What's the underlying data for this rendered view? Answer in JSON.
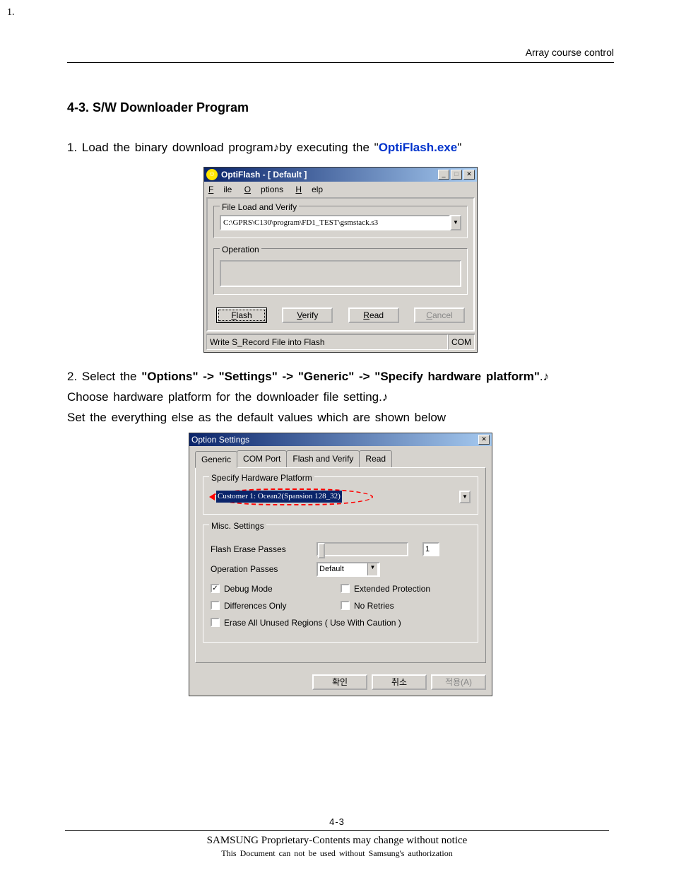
{
  "outer_number": "1.",
  "page_header": "Array course control",
  "section_title": "4-3. S/W Downloader Program",
  "intro": {
    "prefix": "1. Load the binary download program♪by executing the \"",
    "highlight": "OptiFlash.exe",
    "suffix": "\""
  },
  "win1": {
    "title": "OptiFlash - [ Default ]",
    "menu": {
      "file": "File",
      "options": "Options",
      "help": "Help"
    },
    "group1": {
      "legend": "File Load and Verify",
      "path": "C:\\GPRS\\C130\\program\\FD1_TEST\\gsmstack.s3"
    },
    "group2": {
      "legend": "Operation"
    },
    "buttons": {
      "flash": "Flash",
      "verify": "Verify",
      "read": "Read",
      "cancel": "Cancel"
    },
    "status_left": "Write S_Record File into Flash",
    "status_right": "COM"
  },
  "midtext": {
    "line1_prefix": "2. Select the ",
    "line1_bold": "\"Options\" -> \"Settings\" -> \"Generic\" -> \"Specify hardware platform\"",
    "line1_suffix": ".♪",
    "line2": "Choose hardware platform for the downloader file setting.♪",
    "line3": "Set the everything else as the default values which are shown below"
  },
  "win2": {
    "title": "Option Settings",
    "tabs": [
      "Generic",
      "COM Port",
      "Flash and Verify",
      "Read"
    ],
    "group_hw": {
      "legend": "Specify Hardware Platform",
      "value": "Customer 1: Ocean2(Spansion 128_32)"
    },
    "group_misc": {
      "legend": "Misc. Settings",
      "flash_erase_label": "Flash Erase Passes",
      "flash_erase_value": "1",
      "operation_passes_label": "Operation Passes",
      "operation_passes_value": "Default",
      "debug_mode": "Debug Mode",
      "extended_protection": "Extended Protection",
      "differences_only": "Differences Only",
      "no_retries": "No Retries",
      "erase_all": "Erase All Unused Regions ( Use With Caution )"
    },
    "buttons": {
      "ok": "확인",
      "cancel": "취소",
      "apply": "적용(A)"
    }
  },
  "footer": {
    "page_number": "4-3",
    "line1": "SAMSUNG Proprietary-Contents may change without notice",
    "line2": "This Document can not be used without Samsung's authorization"
  }
}
